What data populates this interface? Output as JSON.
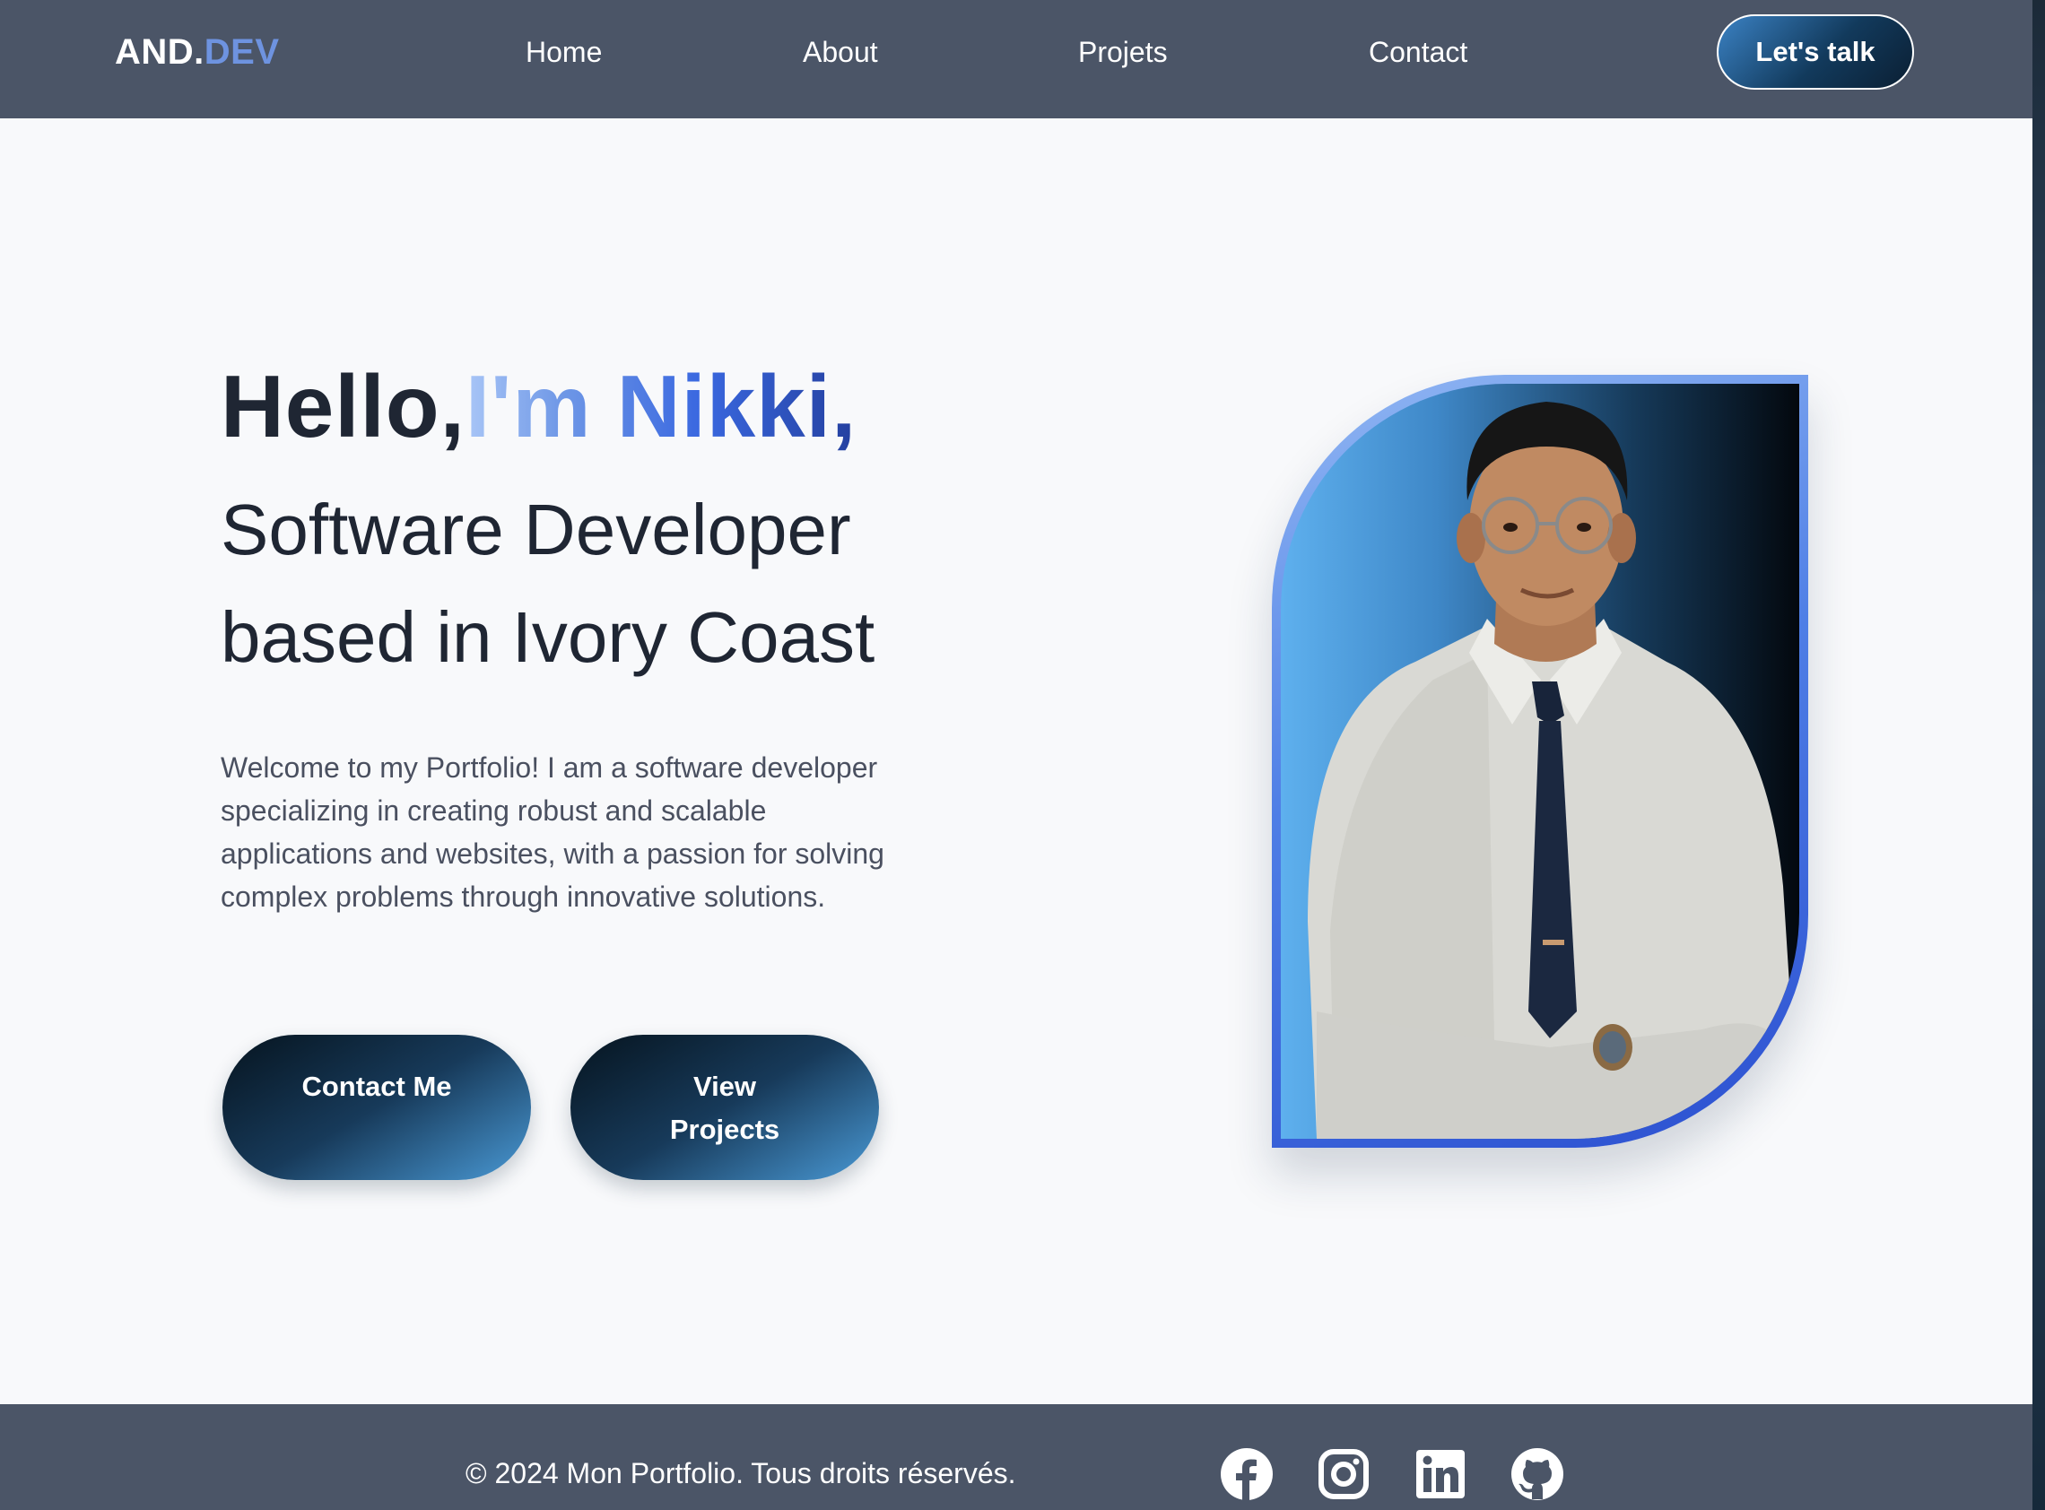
{
  "brand": {
    "main": "AND.",
    "accent": "DEV",
    "accent_color": "#6e93e0"
  },
  "nav": {
    "links": [
      "Home",
      "About",
      "Projets",
      "Contact"
    ],
    "cta": "Let's talk"
  },
  "hero": {
    "hello": "Hello,",
    "name": "I'm Nikki,",
    "role_line1": "Software Developer",
    "role_line2": "based in Ivory Coast",
    "intro": "Welcome to my Portfolio! I am a software developer specializing in creating robust and scalable applications and websites, with a passion for solving complex problems through innovative solutions.",
    "buttons": {
      "contact": "Contact Me",
      "projects_line1": "View",
      "projects_line2": "Projects"
    }
  },
  "footer": {
    "copyright": "© 2024 Mon Portfolio. Tous droits réservés.",
    "social_icons": [
      "facebook-icon",
      "instagram-icon",
      "linkedin-icon",
      "github-icon"
    ]
  },
  "colors": {
    "nav_bg": "#4b5567",
    "page_bg": "#f8f9fb",
    "heading": "#1f2633",
    "name_gradient": [
      "#a9c6f7",
      "#3a68e0",
      "#24409f"
    ]
  }
}
